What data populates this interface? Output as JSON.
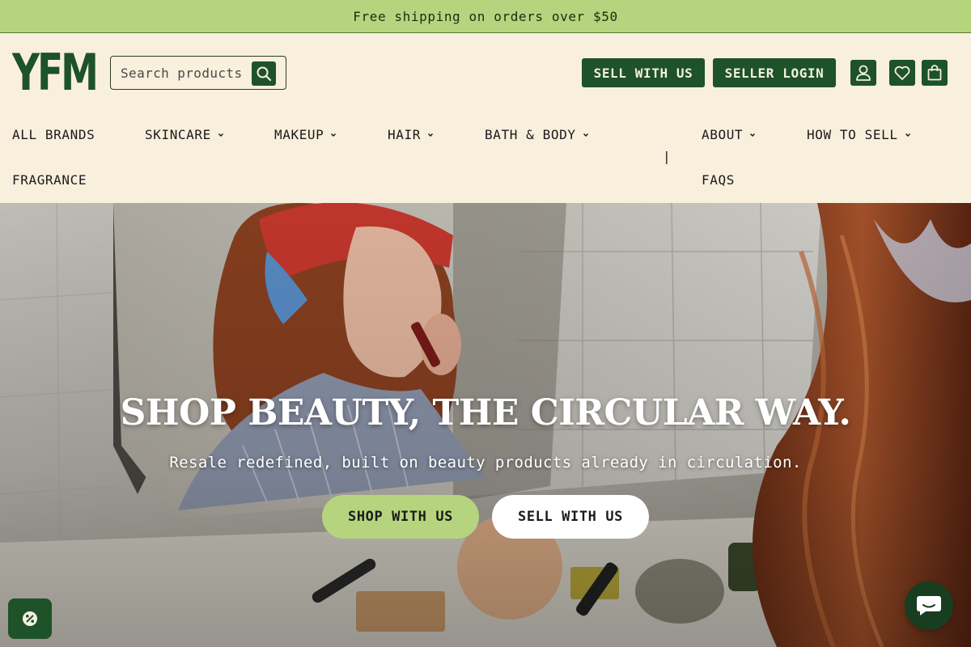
{
  "announcement": {
    "text": "Free shipping on orders over $50"
  },
  "header": {
    "logo_text": "YFM",
    "search": {
      "placeholder": "Search products",
      "value": ""
    },
    "buttons": {
      "sell": "SELL WITH US",
      "login": "SELLER LOGIN"
    },
    "icons": [
      "account-icon",
      "heart-icon",
      "cart-icon",
      "search-icon"
    ]
  },
  "nav": {
    "items": [
      {
        "label": "ALL BRANDS",
        "dropdown": false
      },
      {
        "label": "SKINCARE",
        "dropdown": true
      },
      {
        "label": "MAKEUP",
        "dropdown": true
      },
      {
        "label": "HAIR",
        "dropdown": true
      },
      {
        "label": "BATH & BODY",
        "dropdown": true
      },
      {
        "label": "FRAGRANCE",
        "dropdown": false
      },
      {
        "label": "ABOUT",
        "dropdown": true
      },
      {
        "label": "HOW TO SELL",
        "dropdown": true
      },
      {
        "label": "FAQS",
        "dropdown": false
      }
    ],
    "separator": "|"
  },
  "hero": {
    "title": "SHOP BEAUTY, THE CIRCULAR WAY.",
    "subtitle": "Resale redefined, built on beauty products already in circulation.",
    "cta_shop": "SHOP WITH US",
    "cta_sell": "SELL WITH US"
  },
  "colors": {
    "brand_green": "#1e5228",
    "accent_lime": "#b6d47e",
    "cream": "#f8efdc"
  }
}
